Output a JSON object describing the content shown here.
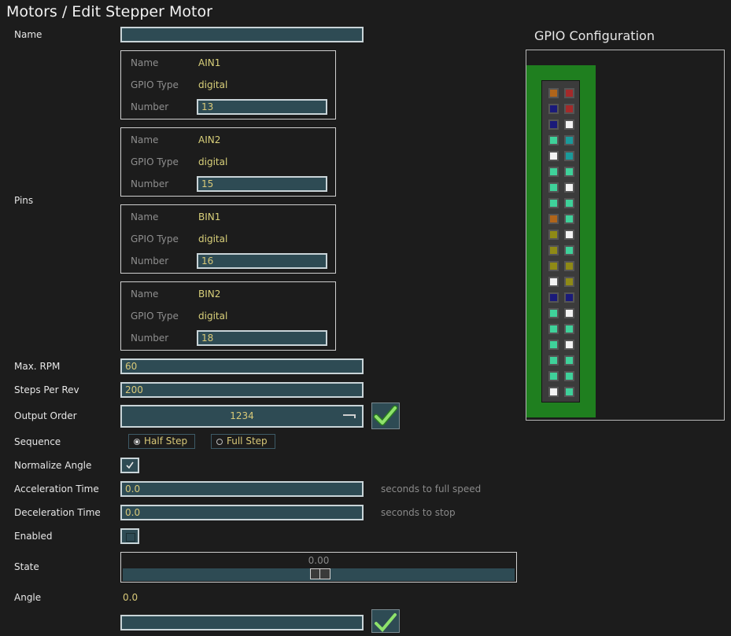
{
  "page": {
    "title": "Motors / Edit Stepper Motor"
  },
  "form": {
    "name_label": "Name",
    "name_value": "",
    "pins_label": "Pins",
    "pins": [
      {
        "name_label": "Name",
        "name": "AIN1",
        "type_label": "GPIO Type",
        "type": "digital",
        "number_label": "Number",
        "number": "13"
      },
      {
        "name_label": "Name",
        "name": "AIN2",
        "type_label": "GPIO Type",
        "type": "digital",
        "number_label": "Number",
        "number": "15"
      },
      {
        "name_label": "Name",
        "name": "BIN1",
        "type_label": "GPIO Type",
        "type": "digital",
        "number_label": "Number",
        "number": "16"
      },
      {
        "name_label": "Name",
        "name": "BIN2",
        "type_label": "GPIO Type",
        "type": "digital",
        "number_label": "Number",
        "number": "18"
      }
    ],
    "max_rpm_label": "Max. RPM",
    "max_rpm": "60",
    "steps_label": "Steps Per Rev",
    "steps": "200",
    "output_order_label": "Output Order",
    "output_order": "1234",
    "sequence_label": "Sequence",
    "sequence_options": [
      "Half Step",
      "Full Step"
    ],
    "sequence_selected": "Half Step",
    "normalize_label": "Normalize Angle",
    "normalize_checked": true,
    "accel_label": "Acceleration Time",
    "accel": "0.0",
    "accel_hint": "seconds to full speed",
    "decel_label": "Deceleration Time",
    "decel": "0.0",
    "decel_hint": "seconds to stop",
    "enabled_label": "Enabled",
    "enabled_checked": false,
    "state_label": "State",
    "state_value": "0.00",
    "angle_label": "Angle",
    "angle": "0.0"
  },
  "gpio": {
    "title": "GPIO Configuration",
    "colors": {
      "orange": "#b0651a",
      "red": "#a32a2a",
      "navy": "#1a1a7a",
      "white": "#f2f2f2",
      "teal": "#1a9a9a",
      "mint": "#3fd19a",
      "olive": "#8f8a16"
    },
    "rows": [
      [
        "orange",
        "red"
      ],
      [
        "navy",
        "red"
      ],
      [
        "navy",
        "white"
      ],
      [
        "mint",
        "teal"
      ],
      [
        "white",
        "teal"
      ],
      [
        "mint",
        "mint"
      ],
      [
        "mint",
        "white"
      ],
      [
        "mint",
        "mint"
      ],
      [
        "orange",
        "mint"
      ],
      [
        "olive",
        "white"
      ],
      [
        "olive",
        "mint"
      ],
      [
        "olive",
        "olive"
      ],
      [
        "white",
        "olive"
      ],
      [
        "navy",
        "navy"
      ],
      [
        "mint",
        "white"
      ],
      [
        "mint",
        "mint"
      ],
      [
        "mint",
        "white"
      ],
      [
        "mint",
        "mint"
      ],
      [
        "mint",
        "mint"
      ],
      [
        "white",
        "mint"
      ]
    ]
  }
}
